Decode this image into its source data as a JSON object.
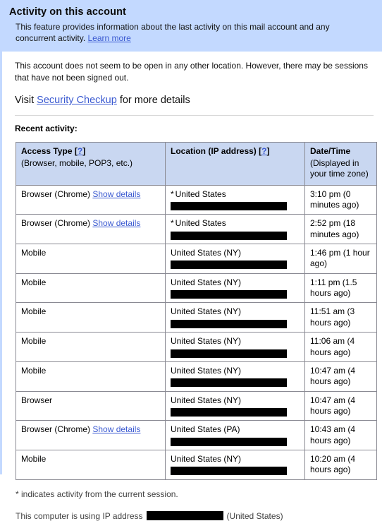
{
  "header": {
    "title": "Activity on this account",
    "description_part1": "This feature provides information about the last activity on this mail account and any concurrent activity. ",
    "learn_more_label": "Learn more"
  },
  "main": {
    "status_text": "This account does not seem to be open in any other location. However, there may be sessions that have not been signed out.",
    "visit_prefix": "Visit ",
    "security_checkup_label": "Security Checkup",
    "visit_suffix": " for more details",
    "recent_activity_label": "Recent activity:"
  },
  "table": {
    "columns": [
      {
        "title": "Access Type",
        "help_bracket_open": "[",
        "help_label": "?",
        "help_bracket_close": "]",
        "subtitle": "(Browser, mobile, POP3, etc.)"
      },
      {
        "title": "Location (IP address)",
        "help_bracket_open": "[",
        "help_label": "?",
        "help_bracket_close": "]",
        "subtitle": ""
      },
      {
        "title": "Date/Time",
        "subtitle": "(Displayed in your time zone)"
      }
    ],
    "rows": [
      {
        "access_type": "Browser (Chrome)",
        "show_details_label": "Show details",
        "current_session_marker": "*",
        "location": "United States",
        "ip_redacted": true,
        "datetime": "3:10 pm (0 minutes ago)"
      },
      {
        "access_type": "Browser (Chrome)",
        "show_details_label": "Show details",
        "current_session_marker": "*",
        "location": "United States",
        "ip_redacted": true,
        "datetime": "2:52 pm (18 minutes ago)"
      },
      {
        "access_type": "Mobile",
        "show_details_label": "",
        "current_session_marker": "",
        "location": "United States (NY)",
        "ip_redacted": true,
        "datetime": "1:46 pm (1 hour ago)"
      },
      {
        "access_type": "Mobile",
        "show_details_label": "",
        "current_session_marker": "",
        "location": "United States (NY)",
        "ip_redacted": true,
        "datetime": "1:11 pm (1.5 hours ago)"
      },
      {
        "access_type": "Mobile",
        "show_details_label": "",
        "current_session_marker": "",
        "location": "United States (NY)",
        "ip_redacted": true,
        "datetime": "11:51 am (3 hours ago)"
      },
      {
        "access_type": "Mobile",
        "show_details_label": "",
        "current_session_marker": "",
        "location": "United States (NY)",
        "ip_redacted": true,
        "datetime": "11:06 am (4 hours ago)"
      },
      {
        "access_type": "Mobile",
        "show_details_label": "",
        "current_session_marker": "",
        "location": "United States (NY)",
        "ip_redacted": true,
        "datetime": "10:47 am (4 hours ago)"
      },
      {
        "access_type": "Browser",
        "show_details_label": "",
        "current_session_marker": "",
        "location": "United States (NY)",
        "ip_redacted": true,
        "datetime": "10:47 am (4 hours ago)"
      },
      {
        "access_type": "Browser (Chrome)",
        "show_details_label": "Show details",
        "current_session_marker": "",
        "location": "United States (PA)",
        "ip_redacted": true,
        "datetime": "10:43 am (4 hours ago)"
      },
      {
        "access_type": "Mobile",
        "show_details_label": "",
        "current_session_marker": "",
        "location": "United States (NY)",
        "ip_redacted": true,
        "datetime": "10:20 am (4 hours ago)"
      }
    ]
  },
  "footer": {
    "footnote": "* indicates activity from the current session.",
    "ip_line_prefix": "This computer is using IP address",
    "ip_redacted": true,
    "ip_line_suffix": "(United States)"
  },
  "colors": {
    "header_background": "#c3d9ff",
    "table_header_background": "#c9d7f1",
    "link": "#3b5ad1",
    "redaction": "#000000",
    "border": "#8a8a93"
  }
}
